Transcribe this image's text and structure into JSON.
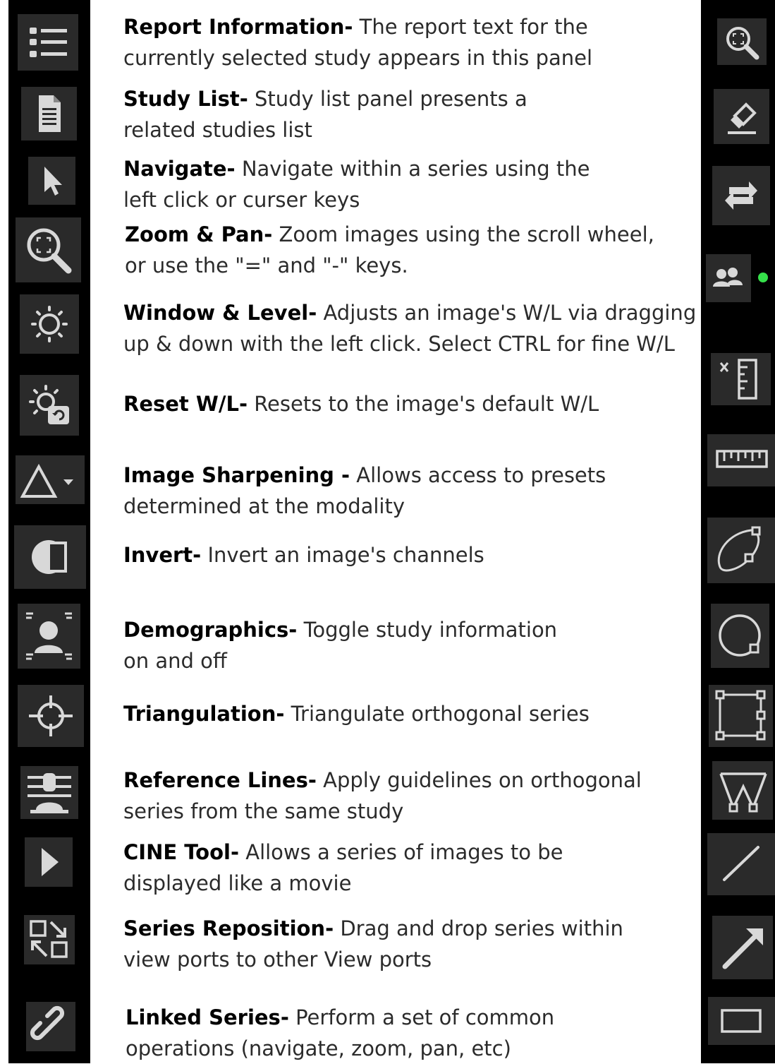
{
  "left_tools": [
    {
      "name": "Report Information-",
      "desc1": "The report text for the",
      "desc2": "currently selected study appears in this panel",
      "icon": "list-icon"
    },
    {
      "name": "Study List-",
      "desc1": "Study list panel presents a",
      "desc2": "related studies list",
      "icon": "document-icon"
    },
    {
      "name": "Navigate-",
      "desc1": "Navigate within a series using the",
      "desc2": "left click or curser keys",
      "icon": "pointer-icon"
    },
    {
      "name": "Zoom & Pan-",
      "desc1": "Zoom images using the scroll wheel,",
      "desc2": "or use the \"=\" and \"-\" keys.",
      "icon": "zoom-icon"
    },
    {
      "name": "Window & Level-",
      "desc1": "Adjusts an image's W/L via dragging",
      "desc2": "up & down with the left click. Select CTRL for fine W/L",
      "icon": "sun-icon"
    },
    {
      "name": "Reset W/L-",
      "desc1": "Resets to the image's default W/L",
      "desc2": "",
      "icon": "sun-reset-icon"
    },
    {
      "name": "Image Sharpening -",
      "desc1": "Allows access to presets",
      "desc2": "determined at the modality",
      "icon": "triangle-dropdown-icon"
    },
    {
      "name": "Invert-",
      "desc1": "Invert an image's channels",
      "desc2": "",
      "icon": "invert-icon"
    },
    {
      "name": "Demographics-",
      "desc1": "Toggle study information",
      "desc2": "on and off",
      "icon": "person-icon"
    },
    {
      "name": "Triangulation-",
      "desc1": "Triangulate orthogonal series",
      "desc2": "",
      "icon": "crosshair-icon"
    },
    {
      "name": "Reference Lines-",
      "desc1": "Apply guidelines on orthogonal",
      "desc2": "series from the same study",
      "icon": "reference-lines-icon"
    },
    {
      "name": "CINE Tool-",
      "desc1": "Allows a series of images to be",
      "desc2": "displayed like a movie",
      "icon": "play-icon"
    },
    {
      "name": "Series Reposition-",
      "desc1": "Drag and drop series within",
      "desc2": "view ports to other View ports",
      "icon": "reposition-icon"
    },
    {
      "name": "Linked Series-",
      "desc1": "Perform a set of common",
      "desc2": "operations (navigate, zoom, pan, etc)",
      "icon": "link-icon"
    }
  ],
  "right_tools": [
    "zoom-icon",
    "eraser-icon",
    "swap-icon",
    "users-icon",
    "calibrate-ruler-icon",
    "ruler-icon",
    "freehand-roi-icon",
    "circle-roi-icon",
    "rectangle-roi-icon",
    "angle-icon",
    "line-icon",
    "arrow-icon",
    "rectangle-icon"
  ],
  "colors": {
    "strip": "#000000",
    "button": "#2a2a2a",
    "icon": "#d8d8d8",
    "status_dot": "#35e04a"
  }
}
